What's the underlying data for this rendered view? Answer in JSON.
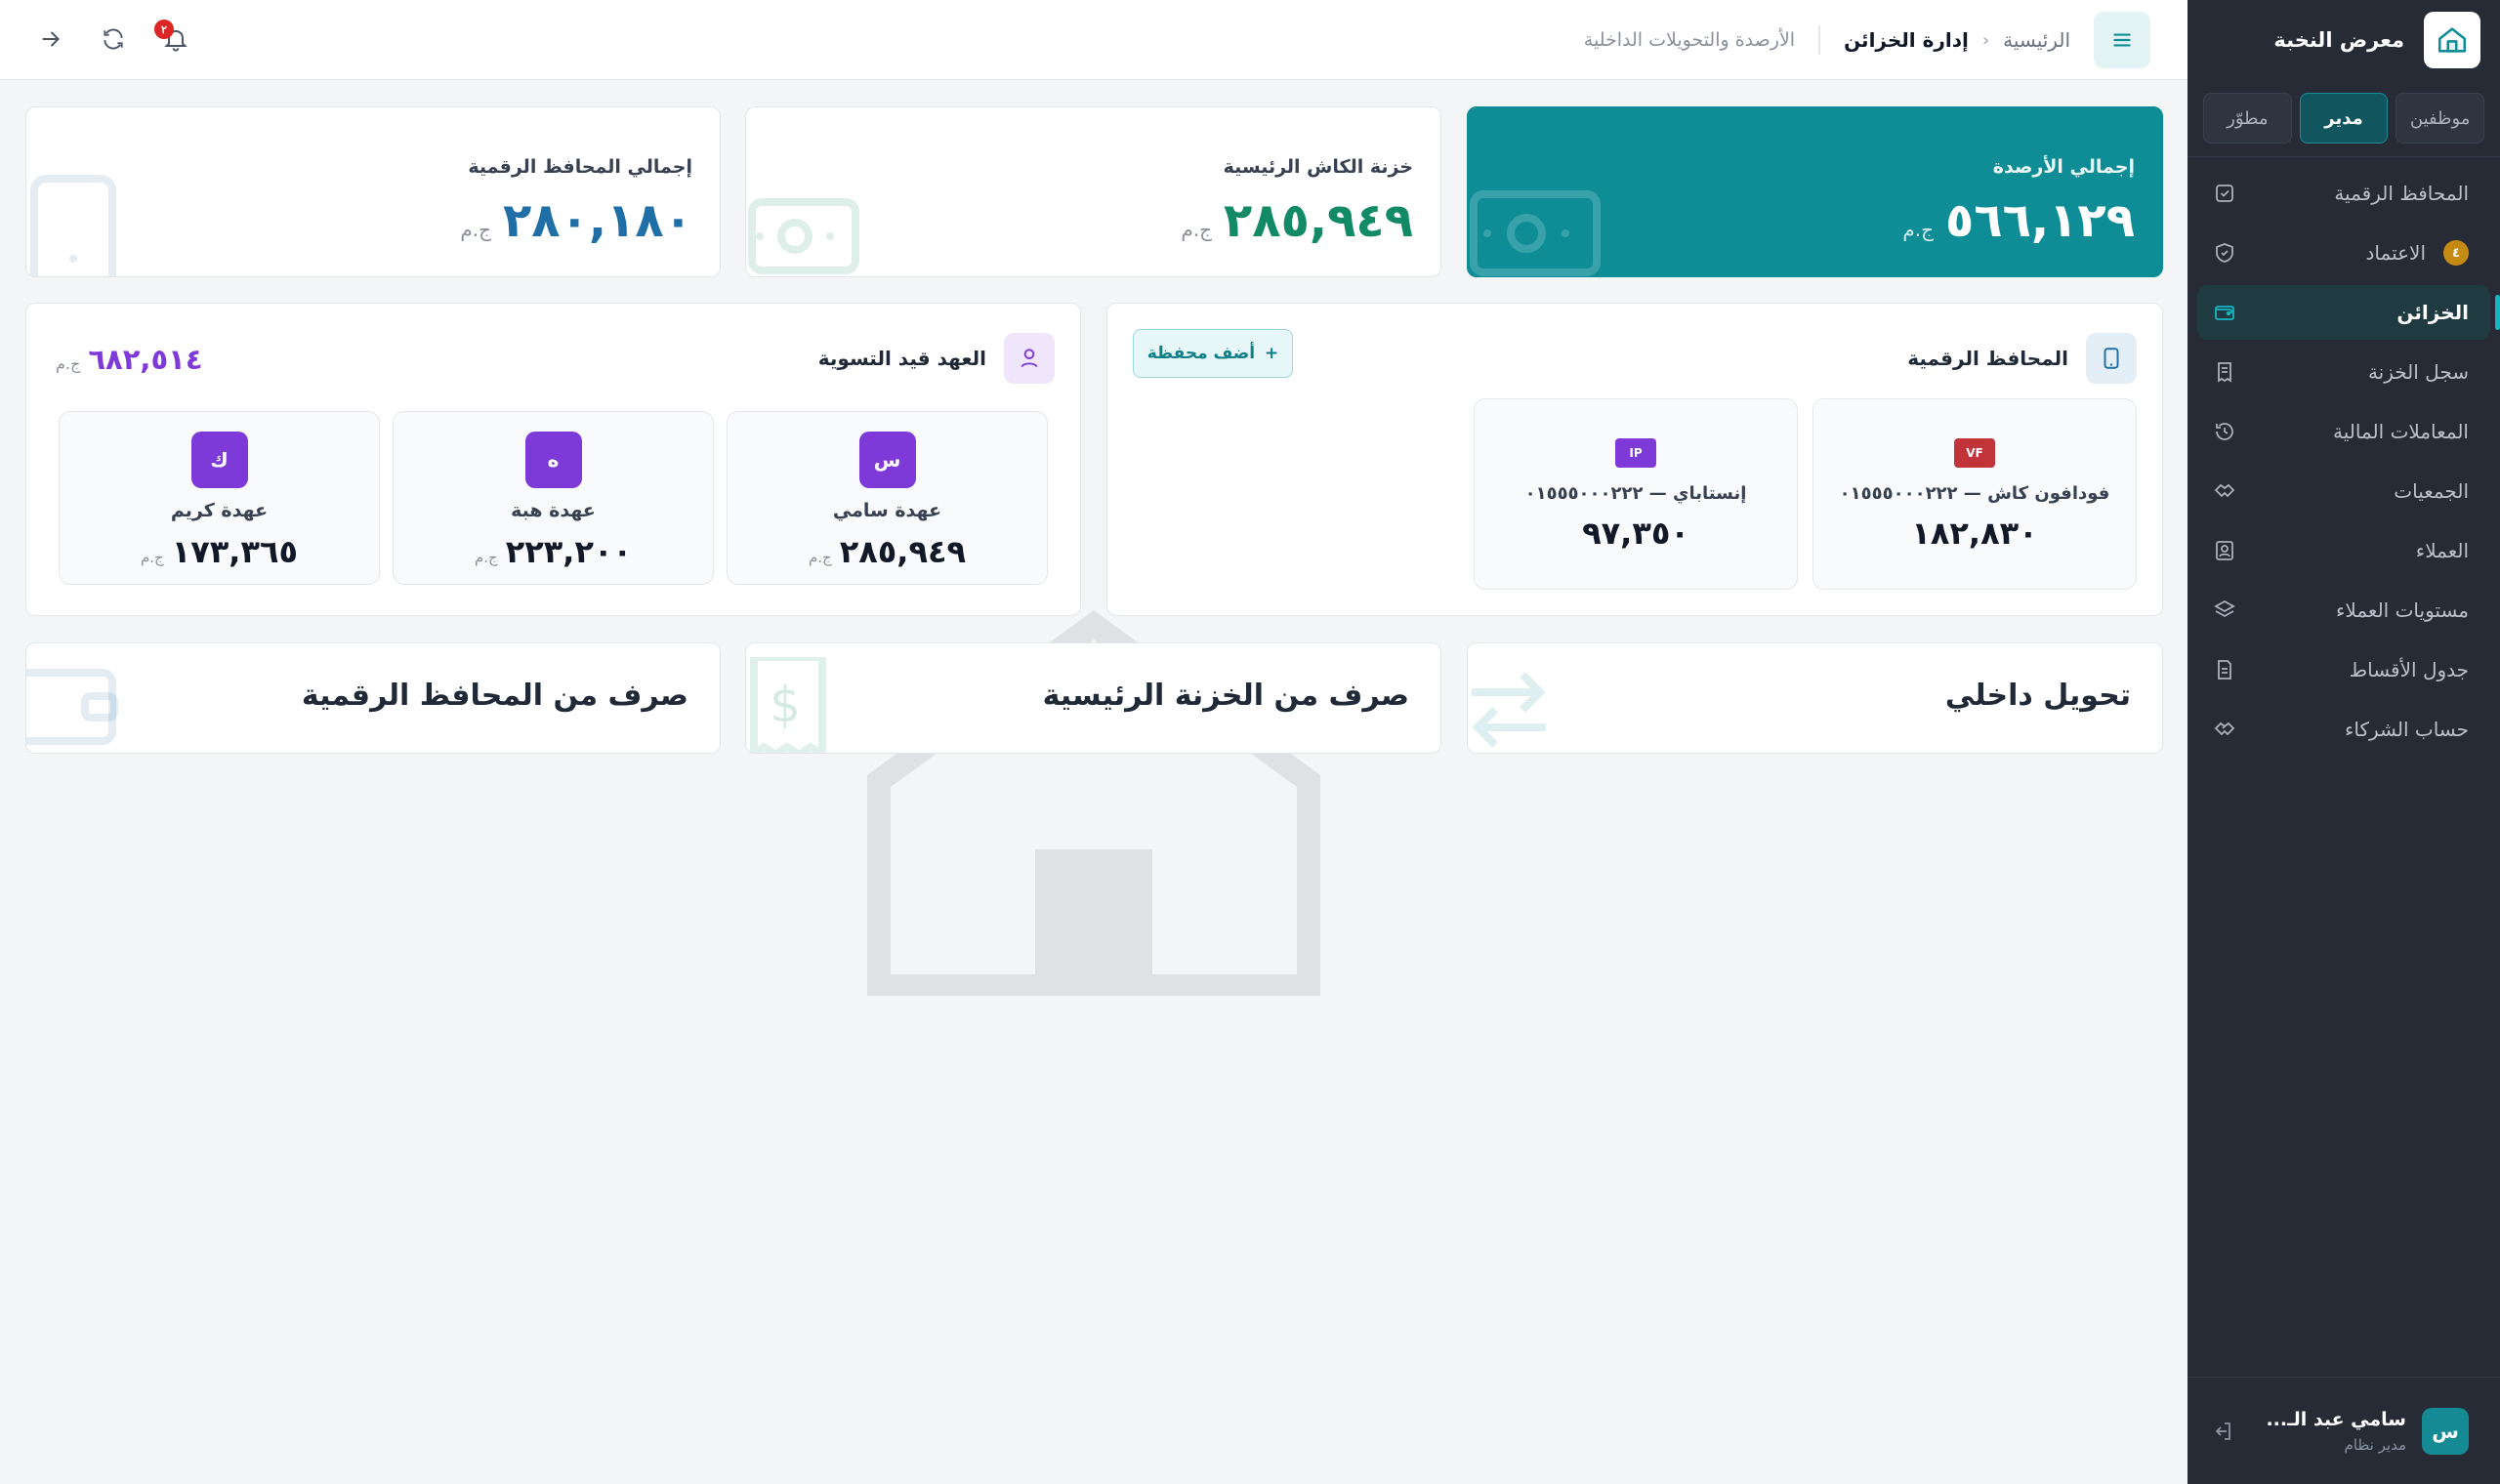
{
  "sidebar": {
    "brand": "معرض النخبة",
    "roles": [
      {
        "label": "موظفين",
        "active": false
      },
      {
        "label": "مدير",
        "active": true
      },
      {
        "label": "مطوّر",
        "active": false
      }
    ],
    "nav": [
      {
        "label": "المحافظ الرقمية",
        "icon": "check-square-icon"
      },
      {
        "label": "الاعتماد",
        "icon": "shield-check-icon",
        "badge": "٤"
      },
      {
        "label": "الخزائن",
        "icon": "wallet-icon",
        "active": true
      },
      {
        "label": "سجل الخزنة",
        "icon": "receipt-icon"
      },
      {
        "label": "المعاملات المالية",
        "icon": "history-icon"
      },
      {
        "label": "الجمعيات",
        "icon": "handshake-icon"
      },
      {
        "label": "العملاء",
        "icon": "contact-icon"
      },
      {
        "label": "مستويات العملاء",
        "icon": "layers-icon"
      },
      {
        "label": "جدول الأقساط",
        "icon": "file-list-icon"
      },
      {
        "label": "حساب الشركاء",
        "icon": "handshake-icon"
      }
    ],
    "user": {
      "initial": "س",
      "name": "سامي عبد الـ...",
      "role": "مدير نظام"
    }
  },
  "topbar": {
    "breadcrumb_home": "الرئيسية",
    "breadcrumb_current": "إدارة الخزائن",
    "subtitle": "الأرصدة والتحويلات الداخلية",
    "notif_count": "٢"
  },
  "stats": [
    {
      "title": "إجمالي الأرصدة",
      "value": "٥٦٦,١٢٩",
      "unit": "ج.م"
    },
    {
      "title": "خزنة الكاش الرئيسية",
      "value": "٢٨٥,٩٤٩",
      "unit": "ج.م"
    },
    {
      "title": "إجمالي المحافظ الرقمية",
      "value": "٢٨٠,١٨٠",
      "unit": "ج.م"
    }
  ],
  "wallets": {
    "title": "المحافظ الرقمية",
    "add_label": "أضف محفظة",
    "items": [
      {
        "tag": "VF",
        "name": "فودافون كاش — ٠١٥٥٥٠٠٠٢٢٢",
        "balance": "١٨٢,٨٣٠",
        "color": "#c0343a"
      },
      {
        "tag": "IP",
        "name": "إنستاباي — ٠١٥٥٥٠٠٠٢٢٢",
        "balance": "٩٧,٣٥٠",
        "color": "#7e3ad9"
      }
    ]
  },
  "custody": {
    "title": "العهد قيد التسوية",
    "total": "٦٨٢,٥١٤",
    "unit": "ج.م",
    "items": [
      {
        "initial": "س",
        "name": "عهدة سامي",
        "balance": "٢٨٥,٩٤٩",
        "unit": "ج.م"
      },
      {
        "initial": "ه",
        "name": "عهدة هبة",
        "balance": "٢٢٣,٢٠٠",
        "unit": "ج.م"
      },
      {
        "initial": "ك",
        "name": "عهدة كريم",
        "balance": "١٧٣,٣٦٥",
        "unit": "ج.م"
      }
    ]
  },
  "actions": [
    {
      "label": "تحويل داخلي"
    },
    {
      "label": "صرف من الخزنة الرئيسية"
    },
    {
      "label": "صرف من المحافظ الرقمية"
    }
  ],
  "colors": {
    "accent": "#0e8d96",
    "custody": "#7e3ad9",
    "cash": "#128a66",
    "digital": "#1f6fa6"
  }
}
